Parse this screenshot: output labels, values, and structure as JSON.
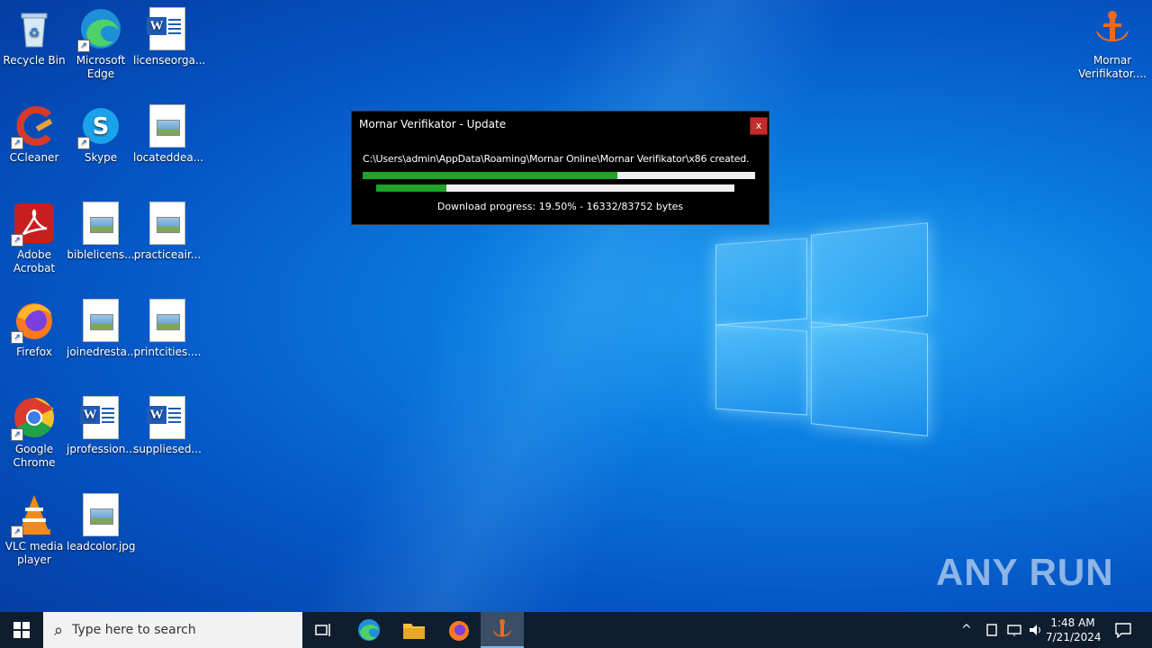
{
  "desktop": {
    "icons": [
      {
        "label": "Recycle Bin"
      },
      {
        "label": "Microsoft Edge"
      },
      {
        "label": "licenseorga..."
      },
      {
        "label": "CCleaner"
      },
      {
        "label": "Skype"
      },
      {
        "label": "locateddea..."
      },
      {
        "label": "Adobe Acrobat"
      },
      {
        "label": "biblelicens..."
      },
      {
        "label": "practiceair..."
      },
      {
        "label": "Firefox"
      },
      {
        "label": "joinedresta..."
      },
      {
        "label": "printcities...."
      },
      {
        "label": "Google Chrome"
      },
      {
        "label": "jprofession..."
      },
      {
        "label": "suppliesed..."
      },
      {
        "label": "VLC media player"
      },
      {
        "label": "leadcolor.jpg"
      },
      {
        "label": "Mornar Verifikator...."
      }
    ]
  },
  "dialog": {
    "title": "Mornar Verifikator - Update",
    "close_label": "x",
    "path_text": "C:\\Users\\admin\\AppData\\Roaming\\Mornar Online\\Mornar Verifikator\\x86 created.",
    "overall_progress": 0.65,
    "download_progress": 0.195,
    "progress_text": "Download progress: 19.50% - 16332/83752 bytes"
  },
  "watermark": {
    "text": "ANY RUN"
  },
  "taskbar": {
    "search_placeholder": "Type here to search",
    "clock_time": "1:48 AM",
    "clock_date": "7/21/2024"
  },
  "colors": {
    "progress_fill": "#1fa32b",
    "close_button": "#c42b2b",
    "taskbar": "#0f1e2e"
  }
}
